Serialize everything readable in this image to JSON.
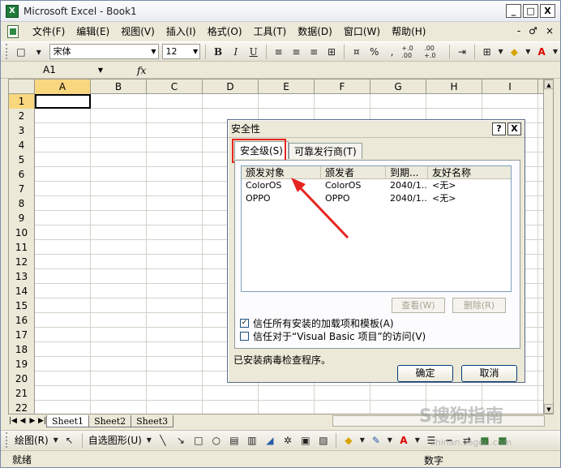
{
  "window": {
    "title": "Microsoft Excel - Book1",
    "app_icon": "X",
    "controls": [
      "_",
      "□",
      "X"
    ]
  },
  "menu": {
    "items": [
      "文件(F)",
      "编辑(E)",
      "视图(V)",
      "插入(I)",
      "格式(O)",
      "工具(T)",
      "数据(D)",
      "窗口(W)",
      "帮助(H)"
    ],
    "right": [
      "-",
      "♂",
      "×"
    ]
  },
  "toolbar": {
    "font_name": "宋体",
    "font_size": "12",
    "bold": "B",
    "italic": "I",
    "underline": "U",
    "percent": "%",
    "comma": ",",
    "inc_decimal": "+.0 .00",
    "dec_decimal": ".00 +.0"
  },
  "formula": {
    "name_box": "A1",
    "fx": "fx"
  },
  "sheet": {
    "columns": [
      "A",
      "B",
      "C",
      "D",
      "E",
      "F",
      "G",
      "H",
      "I"
    ],
    "rows": [
      "1",
      "2",
      "3",
      "4",
      "5",
      "6",
      "7",
      "8",
      "9",
      "10",
      "11",
      "12",
      "13",
      "14",
      "15",
      "16",
      "17",
      "18",
      "19",
      "20",
      "21",
      "22"
    ],
    "tabs": [
      "Sheet1",
      "Sheet2",
      "Sheet3"
    ]
  },
  "drawing": {
    "draw_label": "绘图(R)",
    "autoshape_label": "自选图形(U)"
  },
  "status": {
    "left": "就绪",
    "right": "数字"
  },
  "dialog": {
    "title": "安全性",
    "help": "?",
    "close": "X",
    "tabs": [
      "安全级(S)",
      "可靠发行商(T)"
    ],
    "list_headers": [
      "颁发对象",
      "颁发者",
      "到期...",
      "友好名称"
    ],
    "list_rows": [
      [
        "ColorOS",
        "ColorOS",
        "2040/1...",
        "<无>"
      ],
      [
        "OPPO",
        "OPPO",
        "2040/1...",
        "<无>"
      ]
    ],
    "view_button": "查看(W)",
    "remove_button": "删除(R)",
    "check1": "信任所有安装的加载项和模板(A)",
    "check2": "信任对于“Visual Basic 项目”的访问(V)",
    "check1_mark": "✓",
    "status_text": "已安装病毒检查程序。",
    "ok_button": "确定",
    "cancel_button": "取消"
  },
  "watermark": {
    "text": "S搜狗指南",
    "sub": "zhinan.sogou.com"
  },
  "colors": {
    "highlight_box": "#e5261f",
    "active_header": "#f8d77f"
  }
}
